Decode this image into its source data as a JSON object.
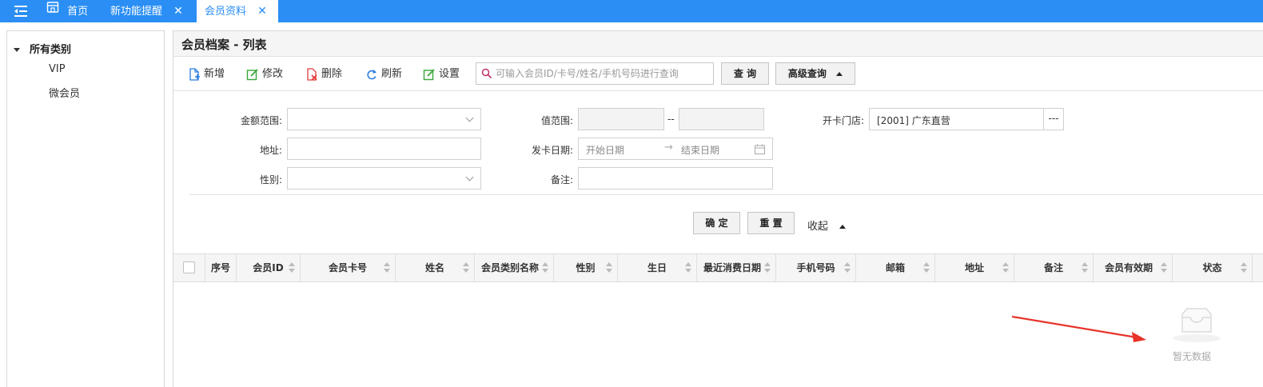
{
  "tabs": [
    {
      "label": "首页"
    },
    {
      "label": "新功能提醒"
    },
    {
      "label": "会员资料"
    }
  ],
  "tree": {
    "root": "所有类别",
    "items": [
      "VIP",
      "微会员"
    ]
  },
  "page": {
    "title": "会员档案 - 列表"
  },
  "toolbar": {
    "add": "新增",
    "edit": "修改",
    "delete": "删除",
    "refresh": "刷新",
    "settings": "设置",
    "search_placeholder": "可输入会员ID/卡号/姓名/手机号码进行查询",
    "query": "查 询",
    "advanced": "高级查询"
  },
  "filters": {
    "amount_label": "金额范围:",
    "value_label": "值范围:",
    "value_sep": "--",
    "store_label": "开卡门店:",
    "store_value": "[2001] 广东直营",
    "store_more": "---",
    "address_label": "地址:",
    "issue_date_label": "发卡日期:",
    "start_placeholder": "开始日期",
    "end_placeholder": "结束日期",
    "gender_label": "性别:",
    "remark_label": "备注:",
    "confirm": "确 定",
    "reset": "重 置",
    "collapse": "收起"
  },
  "table": {
    "columns": [
      "序号",
      "会员ID",
      "会员卡号",
      "姓名",
      "会员类别名称",
      "性别",
      "生日",
      "最近消费日期",
      "手机号码",
      "邮箱",
      "地址",
      "备注",
      "会员有效期",
      "状态"
    ],
    "empty_text": "暂无数据"
  },
  "colors": {
    "topbar": "#2a8ef4",
    "arrow": "#e8332a"
  }
}
